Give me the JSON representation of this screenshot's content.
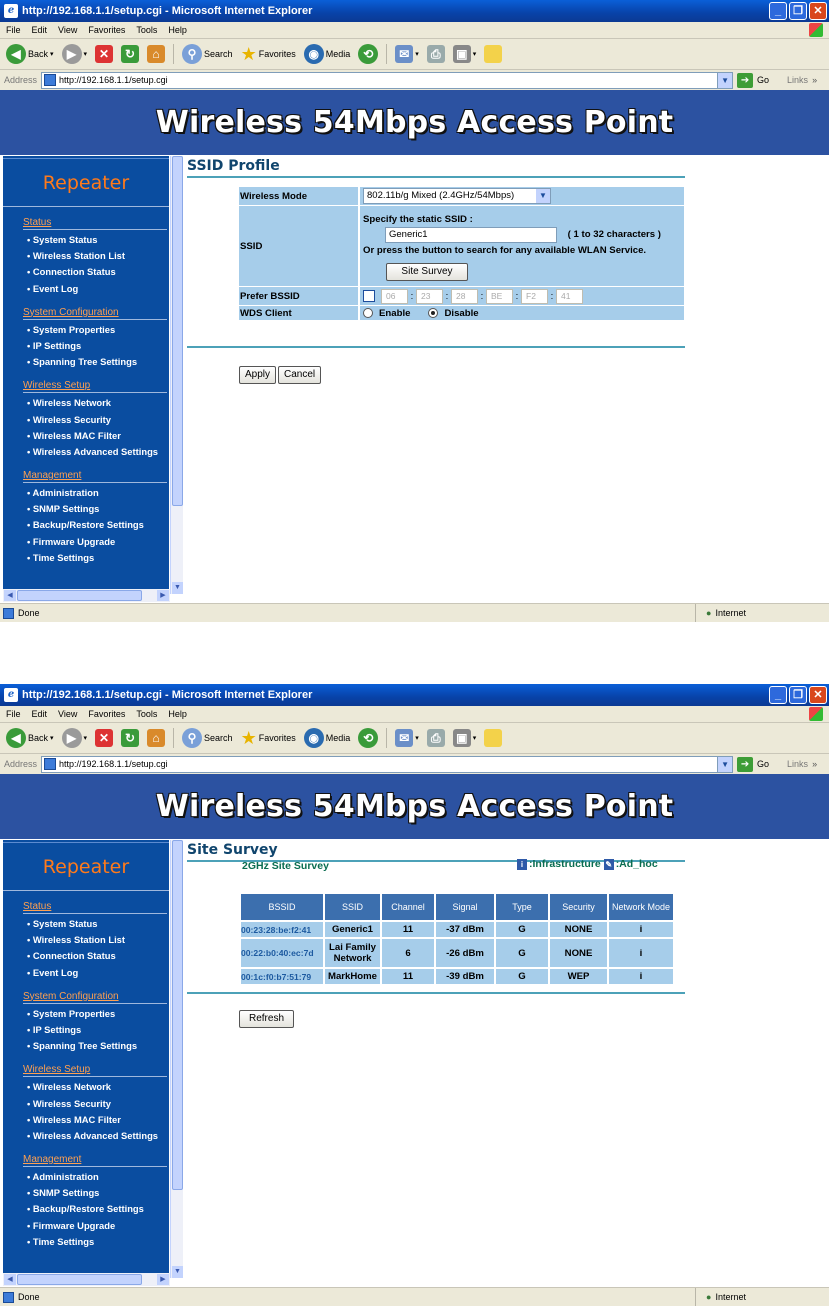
{
  "browser": {
    "title": "http://192.168.1.1/setup.cgi - Microsoft Internet Explorer",
    "menu": [
      "File",
      "Edit",
      "View",
      "Favorites",
      "Tools",
      "Help"
    ],
    "toolbar": {
      "back": "Back",
      "search": "Search",
      "favorites": "Favorites",
      "media": "Media"
    },
    "address_label": "Address",
    "url": "http://192.168.1.1/setup.cgi",
    "go": "Go",
    "links": "Links",
    "status_left": "Done",
    "status_zone": "Internet"
  },
  "page": {
    "banner": "Wireless 54Mbps Access Point",
    "mode": "Repeater"
  },
  "sidebar": {
    "sections": [
      {
        "title": "Status",
        "items": [
          "System Status",
          "Wireless Station List",
          "Connection Status",
          "Event Log"
        ]
      },
      {
        "title": "System Configuration",
        "items": [
          "System Properties",
          "IP Settings",
          "Spanning Tree Settings"
        ]
      },
      {
        "title": "Wireless Setup",
        "items": [
          "Wireless Network",
          "Wireless Security",
          "Wireless MAC Filter",
          "Wireless Advanced Settings"
        ]
      },
      {
        "title": "Management",
        "items": [
          "Administration",
          "SNMP Settings",
          "Backup/Restore Settings",
          "Firmware Upgrade",
          "Time Settings"
        ]
      }
    ]
  },
  "ssid_profile": {
    "title": "SSID Profile",
    "wireless_mode_label": "Wireless Mode",
    "wireless_mode_value": "802.11b/g Mixed (2.4GHz/54Mbps)",
    "ssid_label": "SSID",
    "ssid_hint": "Specify the static SSID  :",
    "ssid_value": "Generic1",
    "ssid_range": "( 1 to 32 characters )",
    "ssid_search_hint": "Or press the button to search for any available WLAN Service.",
    "site_survey_button": "Site Survey",
    "prefer_bssid_label": "Prefer BSSID",
    "bssid_octets": [
      "06",
      "23",
      "28",
      "BE",
      "F2",
      "41"
    ],
    "wds_label": "WDS Client",
    "wds_enable": "Enable",
    "wds_disable": "Disable",
    "wds_selected": "Disable",
    "apply": "Apply",
    "cancel": "Cancel"
  },
  "site_survey": {
    "title": "Site Survey",
    "subtitle": "2GHz Site Survey",
    "legend_infra": ":Infrastructure",
    "legend_adhoc": ":Ad_hoc",
    "columns": [
      "BSSID",
      "SSID",
      "Channel",
      "Signal",
      "Type",
      "Security",
      "Network Mode"
    ],
    "rows": [
      {
        "bssid": "00:23:28:be:f2:41",
        "ssid": "Generic1",
        "channel": "11",
        "signal": "-37 dBm",
        "type": "G",
        "security": "NONE",
        "mode": "i"
      },
      {
        "bssid": "00:22:b0:40:ec:7d",
        "ssid": "Lai Family Network",
        "channel": "6",
        "signal": "-26 dBm",
        "type": "G",
        "security": "NONE",
        "mode": "i"
      },
      {
        "bssid": "00:1c:f0:b7:51:79",
        "ssid": "MarkHome",
        "channel": "11",
        "signal": "-39 dBm",
        "type": "G",
        "security": "WEP",
        "mode": "i"
      }
    ],
    "refresh": "Refresh"
  }
}
